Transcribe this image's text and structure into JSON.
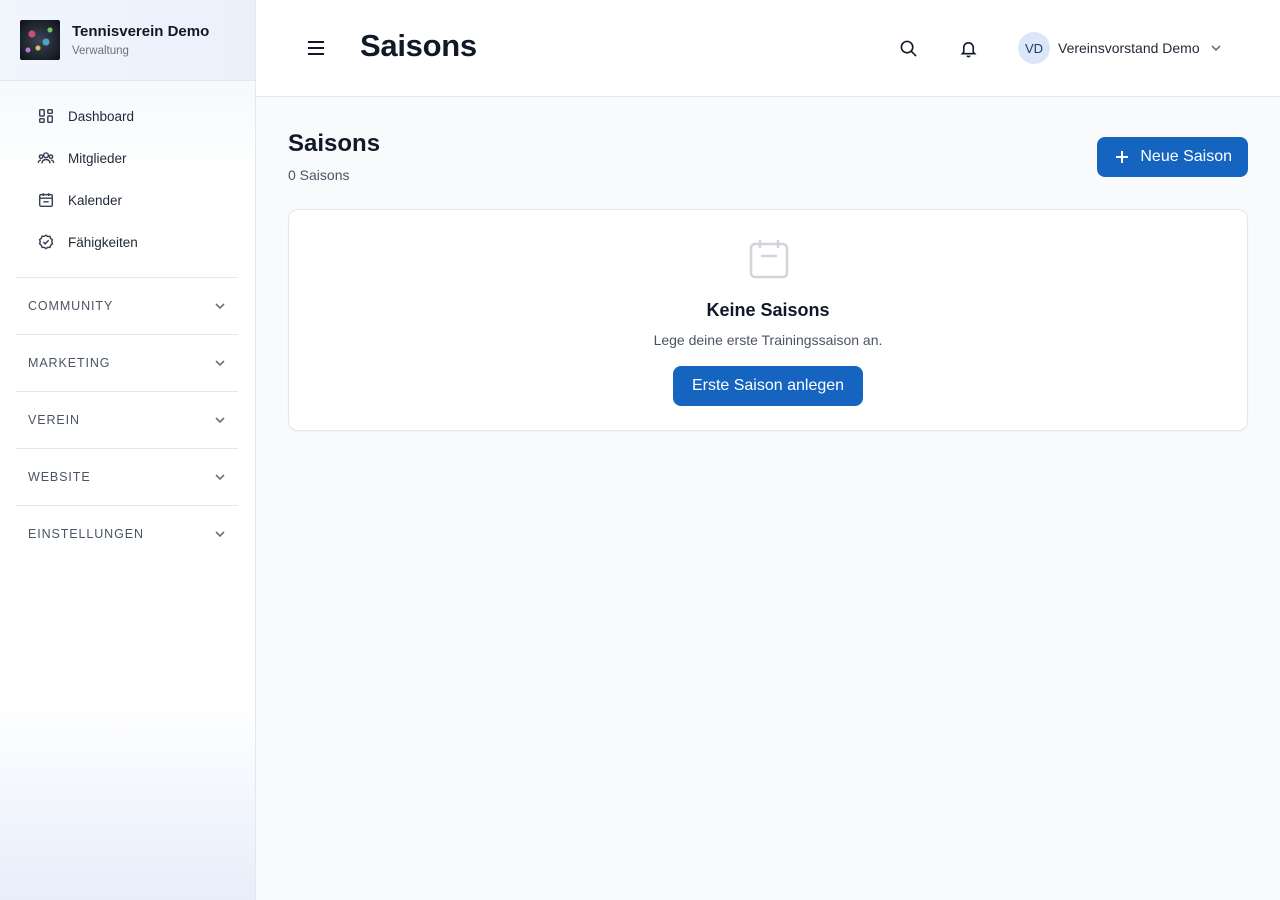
{
  "brand": {
    "title": "Tennisverein Demo",
    "subtitle": "Verwaltung"
  },
  "sidebar": {
    "items": [
      {
        "label": "Dashboard",
        "icon": "dashboard-icon"
      },
      {
        "label": "Mitglieder",
        "icon": "users-icon"
      },
      {
        "label": "Kalender",
        "icon": "calendar-icon"
      },
      {
        "label": "Fähigkeiten",
        "icon": "check-circle-icon"
      }
    ],
    "groups": [
      {
        "label": "COMMUNITY"
      },
      {
        "label": "MARKETING"
      },
      {
        "label": "VEREIN"
      },
      {
        "label": "WEBSITE"
      },
      {
        "label": "EINSTELLUNGEN"
      }
    ]
  },
  "header": {
    "title": "Saisons",
    "user": {
      "initials": "VD",
      "name": "Vereinsvorstand Demo"
    }
  },
  "main": {
    "title": "Saisons",
    "count": "0 Saisons",
    "new_button": "Neue Saison",
    "empty": {
      "title": "Keine Saisons",
      "description": "Lege deine erste Trainingssaison an.",
      "button": "Erste Saison anlegen"
    }
  },
  "colors": {
    "primary": "#1565c0",
    "avatar_bg": "#dbe7f8"
  }
}
